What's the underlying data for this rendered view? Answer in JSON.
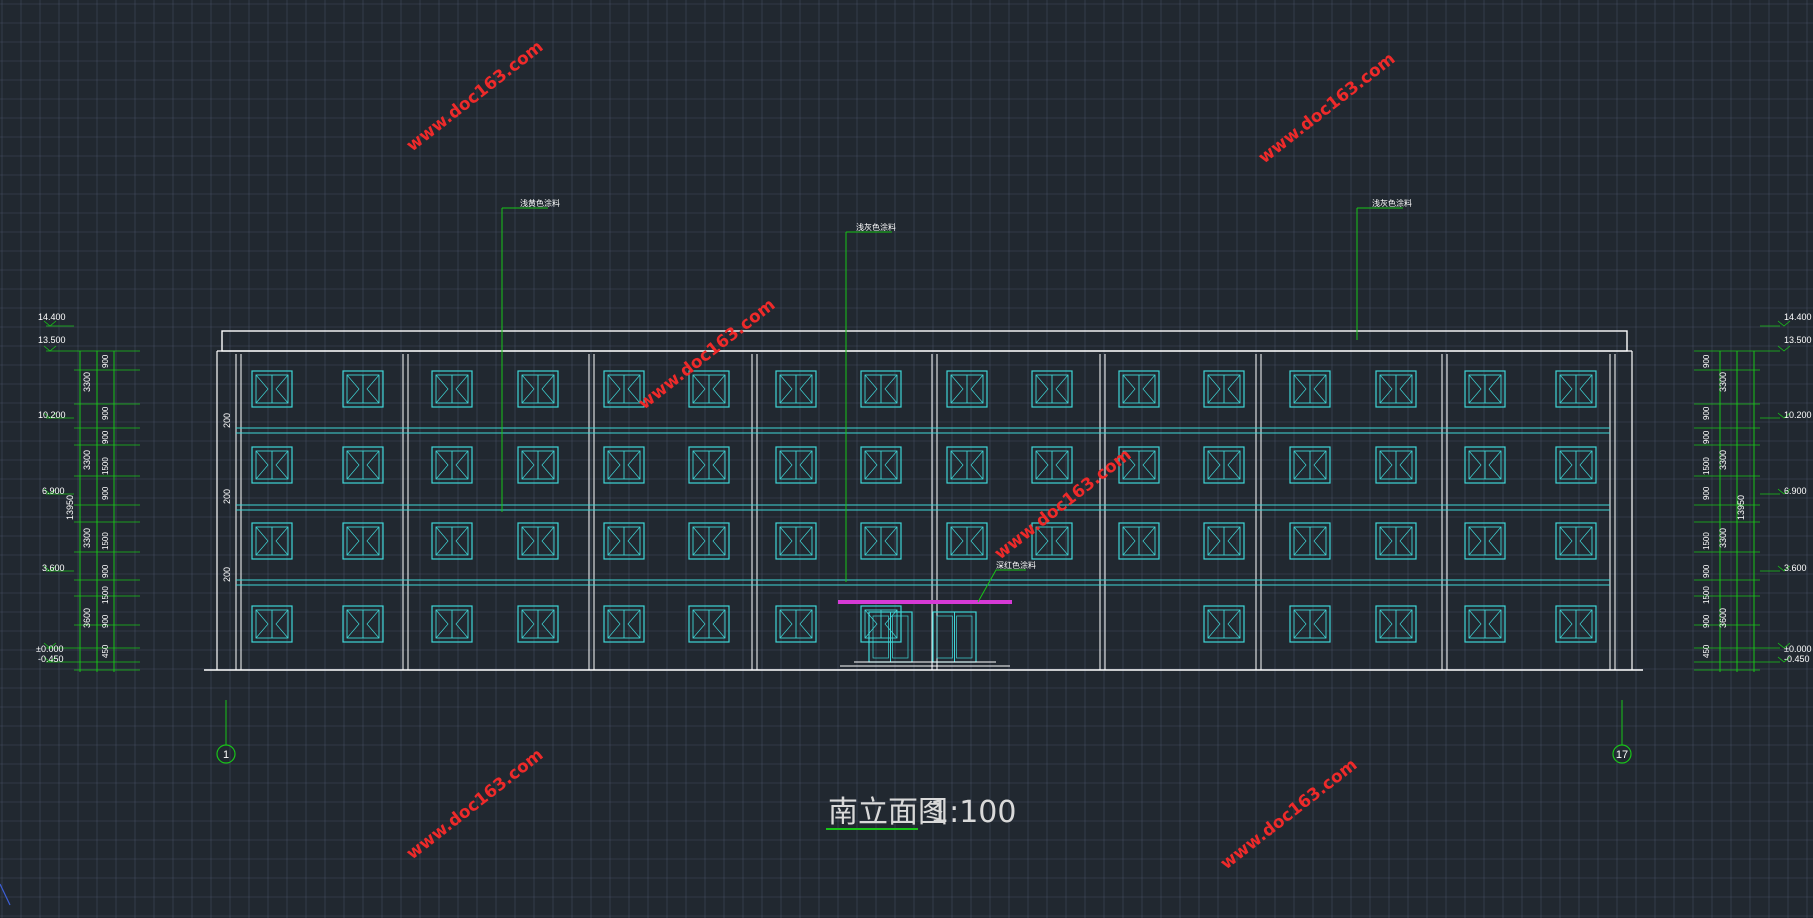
{
  "drawing": {
    "title_cn": "南立面图",
    "scale": "1:100",
    "axis_start": "1",
    "axis_end": "17",
    "callouts": [
      "浅黄色涂料",
      "浅灰色涂料",
      "浅灰色涂料",
      "深红色涂料"
    ],
    "watermark": "www.doc163.com",
    "elevations": {
      "left": [
        "14.400",
        "13.500",
        "10.200",
        "6.900",
        "3.600",
        "±0.000",
        "-0.450"
      ],
      "right": [
        "14.400",
        "13.500",
        "10.200",
        "6.900",
        "3.600",
        "±0.000",
        "-0.450"
      ]
    },
    "dims": {
      "inner": [
        "900",
        "900",
        "900",
        "1500",
        "900",
        "1500",
        "900",
        "1500",
        "900",
        "1500",
        "900",
        "450"
      ],
      "outer": [
        "3300",
        "3300",
        "3300",
        "3600"
      ],
      "total": "13950",
      "wall_offsets": [
        "200",
        "200",
        "200"
      ]
    }
  },
  "colors": {
    "background": "#212830",
    "grid": "#5c6680",
    "outline": "#ffffff",
    "window": "#3fd6d6",
    "dimension": "#18c418",
    "canopy": "#d63ad6",
    "watermark": "#ee2a2a"
  }
}
